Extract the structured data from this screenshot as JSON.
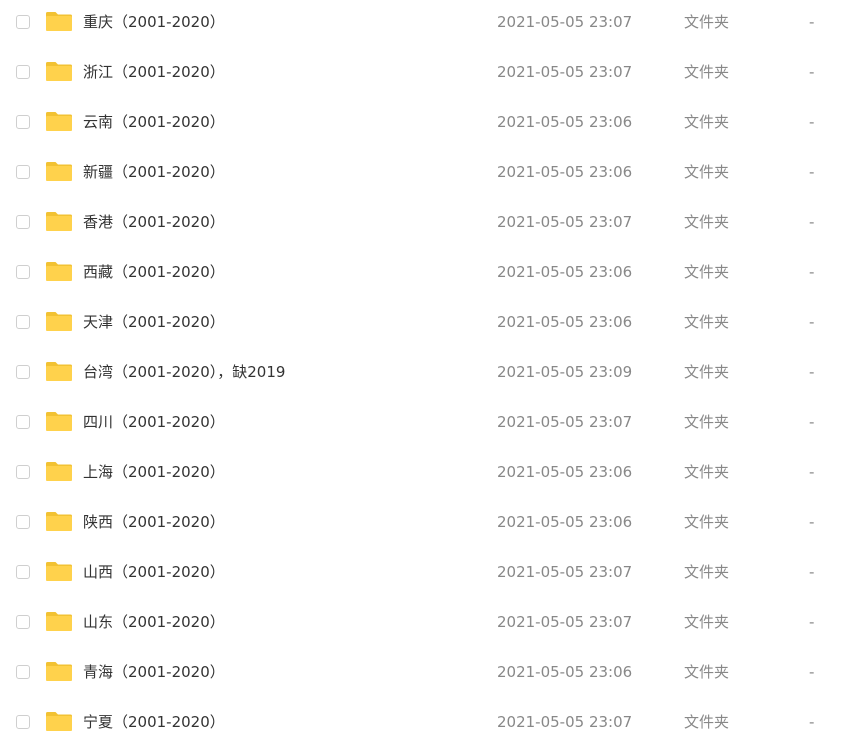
{
  "colors": {
    "folder": "#ffd24c",
    "folder_tab": "#f2c233",
    "name_text": "#333333",
    "meta_text": "#888888",
    "checkbox_border": "#cfcfcf"
  },
  "icons": {
    "folder": "folder-icon",
    "checkbox": "checkbox-icon"
  },
  "rows": [
    {
      "name": "重庆（2001-2020）",
      "date": "2021-05-05 23:07",
      "type": "文件夹",
      "size": "-"
    },
    {
      "name": "浙江（2001-2020）",
      "date": "2021-05-05 23:07",
      "type": "文件夹",
      "size": "-"
    },
    {
      "name": "云南（2001-2020）",
      "date": "2021-05-05 23:06",
      "type": "文件夹",
      "size": "-"
    },
    {
      "name": "新疆（2001-2020）",
      "date": "2021-05-05 23:06",
      "type": "文件夹",
      "size": "-"
    },
    {
      "name": "香港（2001-2020）",
      "date": "2021-05-05 23:07",
      "type": "文件夹",
      "size": "-"
    },
    {
      "name": "西藏（2001-2020）",
      "date": "2021-05-05 23:06",
      "type": "文件夹",
      "size": "-"
    },
    {
      "name": "天津（2001-2020）",
      "date": "2021-05-05 23:06",
      "type": "文件夹",
      "size": "-"
    },
    {
      "name": "台湾（2001-2020），缺2019",
      "date": "2021-05-05 23:09",
      "type": "文件夹",
      "size": "-"
    },
    {
      "name": "四川（2001-2020）",
      "date": "2021-05-05 23:07",
      "type": "文件夹",
      "size": "-"
    },
    {
      "name": "上海（2001-2020）",
      "date": "2021-05-05 23:06",
      "type": "文件夹",
      "size": "-"
    },
    {
      "name": "陕西（2001-2020）",
      "date": "2021-05-05 23:06",
      "type": "文件夹",
      "size": "-"
    },
    {
      "name": "山西（2001-2020）",
      "date": "2021-05-05 23:07",
      "type": "文件夹",
      "size": "-"
    },
    {
      "name": "山东（2001-2020）",
      "date": "2021-05-05 23:07",
      "type": "文件夹",
      "size": "-"
    },
    {
      "name": "青海（2001-2020）",
      "date": "2021-05-05 23:06",
      "type": "文件夹",
      "size": "-"
    },
    {
      "name": "宁夏（2001-2020）",
      "date": "2021-05-05 23:07",
      "type": "文件夹",
      "size": "-"
    }
  ]
}
